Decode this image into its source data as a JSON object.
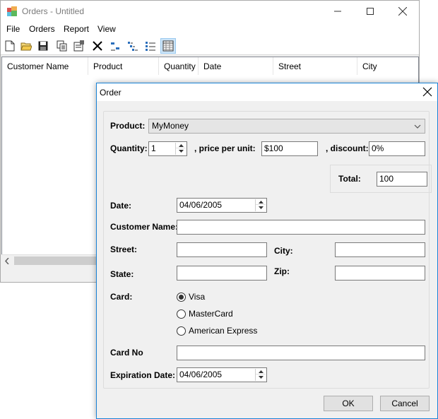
{
  "main_window": {
    "title": "Orders - Untitled",
    "menu": [
      "File",
      "Orders",
      "Report",
      "View"
    ],
    "toolbar_icons": [
      "new-document-icon",
      "open-folder-icon",
      "save-icon",
      "copy-icon",
      "properties-icon",
      "delete-icon",
      "small-icons-view-icon",
      "list-view-icon",
      "details-list-view-icon",
      "grid-view-icon"
    ],
    "columns": [
      "Customer Name",
      "Product",
      "Quantity",
      "Date",
      "Street",
      "City"
    ]
  },
  "dialog": {
    "title": "Order",
    "product": {
      "label": "Product:",
      "value": "MyMoney"
    },
    "quantity": {
      "label": "Quantity:",
      "value": "1"
    },
    "price": {
      "label": ", price per unit:",
      "value": "$100"
    },
    "discount": {
      "label": ", discount:",
      "value": "0%"
    },
    "total": {
      "label": "Total:",
      "value": "100"
    },
    "date": {
      "label": "Date:",
      "value": "04/06/2005"
    },
    "customer_name": {
      "label": "Customer Name:",
      "value": ""
    },
    "street": {
      "label": "Street:",
      "value": ""
    },
    "city": {
      "label": "City:",
      "value": ""
    },
    "state": {
      "label": "State:",
      "value": ""
    },
    "zip": {
      "label": "Zip:",
      "value": ""
    },
    "card": {
      "label": "Card:",
      "options": [
        "Visa",
        "MasterCard",
        "American Express"
      ],
      "selected": "Visa"
    },
    "card_no": {
      "label": "Card No",
      "value": ""
    },
    "expiration": {
      "label": "Expiration Date:",
      "value": "04/06/2005"
    },
    "ok_label": "OK",
    "cancel_label": "Cancel"
  },
  "colors": {
    "dialog_border": "#1883d7",
    "toolbar_active": "#cce4f7"
  }
}
